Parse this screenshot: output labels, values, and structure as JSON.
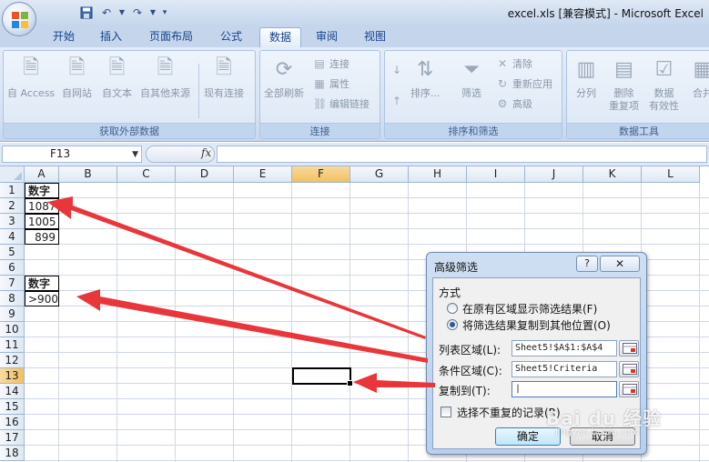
{
  "window": {
    "title": "excel.xls  [兼容模式] - Microsoft Excel"
  },
  "tabs": [
    {
      "label": "开始"
    },
    {
      "label": "插入"
    },
    {
      "label": "页面布局"
    },
    {
      "label": "公式"
    },
    {
      "label": "数据",
      "active": true
    },
    {
      "label": "审阅"
    },
    {
      "label": "视图"
    }
  ],
  "ribbon": {
    "get_external_data": {
      "label": "获取外部数据",
      "from_access": "自 Access",
      "from_web": "自网站",
      "from_text": "自文本",
      "from_other": "自其他来源",
      "existing_connections": "现有连接"
    },
    "connections": {
      "label": "连接",
      "refresh_all": "全部刷新",
      "connections_btn": "连接",
      "properties": "属性",
      "edit_links": "编辑链接"
    },
    "sort_filter": {
      "label": "排序和筛选",
      "sort": "排序...",
      "filter": "筛选",
      "clear": "清除",
      "reapply": "重新应用",
      "advanced": "高级"
    },
    "data_tools": {
      "label": "数据工具",
      "text_to_columns": "分列",
      "remove_duplicates_1": "删除",
      "remove_duplicates_2": "重复项",
      "data_validation_1": "数据",
      "data_validation_2": "有效性",
      "consolidate": "合并"
    }
  },
  "formula_bar": {
    "name_box": "F13",
    "fx": "fx",
    "value": ""
  },
  "sheet": {
    "columns": [
      "A",
      "B",
      "C",
      "D",
      "E",
      "F",
      "G",
      "H",
      "I",
      "J",
      "K",
      "L"
    ],
    "rows": [
      "1",
      "2",
      "3",
      "4",
      "5",
      "6",
      "7",
      "8",
      "9",
      "10",
      "11",
      "12",
      "13",
      "14",
      "15",
      "16",
      "17",
      "18"
    ],
    "active_column": "F",
    "active_row": "13",
    "cells": {
      "A1": "数字",
      "A2": "1087",
      "A3": "1005",
      "A4": "899",
      "A7": "数字",
      "A8": ">900"
    }
  },
  "dialog": {
    "title": "高级筛选",
    "help": "?",
    "close": "✕",
    "section_label": "方式",
    "option_in_place": "在原有区域显示筛选结果(F)",
    "option_copy": "将筛选结果复制到其他位置(O)",
    "list_range_label": "列表区域(L):",
    "list_range_value": "Sheet5!$A$1:$A$4",
    "criteria_range_label": "条件区域(C):",
    "criteria_range_value": "Sheet5!Criteria",
    "copy_to_label": "复制到(T):",
    "copy_to_value": "|",
    "unique_only": "选择不重复的记录(R)",
    "ok": "确定",
    "cancel": "取消"
  },
  "watermark": {
    "text": "Bai du 经验",
    "sub": "jingyan.baidu.com"
  },
  "colors": {
    "ribbon_bg": "#dce7f5",
    "tab_text": "#15428b",
    "annotation_arrow": "#e8363a",
    "active_header": "#f1c15f"
  }
}
